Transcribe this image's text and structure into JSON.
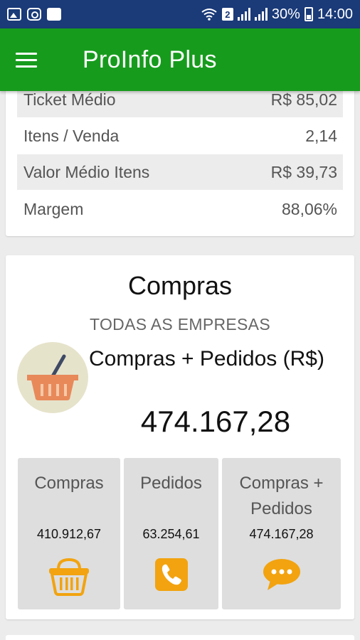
{
  "status_bar": {
    "left_icons": [
      "image-icon",
      "instagram-icon",
      "photo-icon"
    ],
    "sim_badge": "2",
    "battery": "30%",
    "time": "14:00"
  },
  "app_bar": {
    "menu_icon": "hamburger-icon",
    "title": "ProInfo Plus"
  },
  "metrics": [
    {
      "label": "Ticket Médio",
      "value": "R$ 85,02"
    },
    {
      "label": "Itens / Venda",
      "value": "2,14"
    },
    {
      "label": "Valor Médio Itens",
      "value": "R$ 39,73"
    },
    {
      "label": "Margem",
      "value": "88,06%"
    }
  ],
  "compras": {
    "title": "Compras",
    "subtitle": "TODAS AS EMPRESAS",
    "label": "Compras + Pedidos (R$)",
    "value": "474.167,28",
    "icon": "basket-icon",
    "tiles": [
      {
        "label": "Compras",
        "value": "410.912,67",
        "icon": "basket-icon"
      },
      {
        "label": "Pedidos",
        "value": "63.254,61",
        "icon": "phone-icon"
      },
      {
        "label": "Compras + Pedidos",
        "value": "474.167,28",
        "icon": "chat-icon"
      }
    ]
  },
  "colors": {
    "status_bar": "#1a3a78",
    "app_bar": "#179b1d",
    "accent_orange": "#f2a30f",
    "basket_orange": "#e8895a"
  }
}
